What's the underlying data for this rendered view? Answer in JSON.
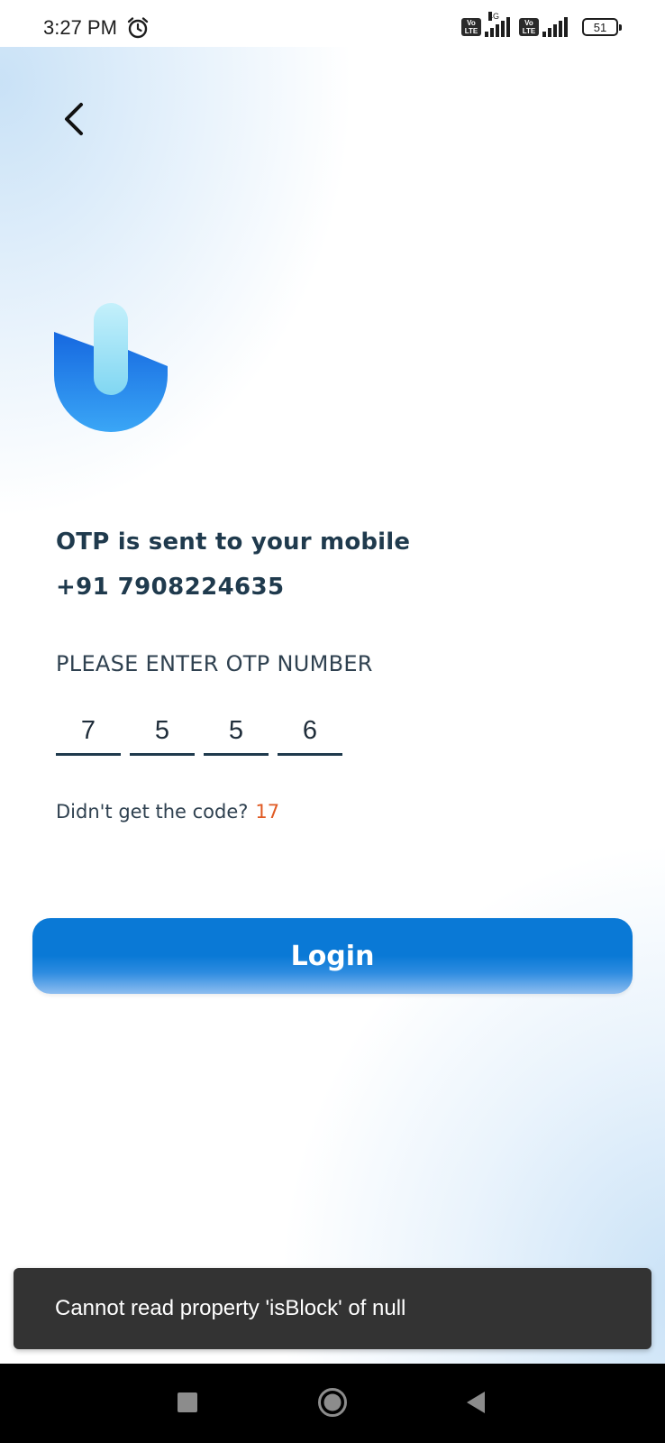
{
  "status_bar": {
    "time": "3:27 PM",
    "alarm_icon": "alarm-clock-icon",
    "volte_label_1": "Vo LTE",
    "network_type": "4G",
    "volte_label_2": "Vo LTE",
    "battery_level": "51"
  },
  "header": {
    "back_icon": "chevron-left-icon"
  },
  "logo": {
    "icon": "brand-logo-icon",
    "colors": {
      "top": "#9fe4f6",
      "bottom": "#1e7be8"
    }
  },
  "otp": {
    "sent_message": "OTP is sent to your mobile",
    "phone_number": "+91 7908224635",
    "enter_label": "PLEASE ENTER OTP NUMBER",
    "digits": [
      "7",
      "5",
      "5",
      "6"
    ],
    "resend_prompt": "Didn't get the code?",
    "resend_timer": "17"
  },
  "login_button": {
    "label": "Login"
  },
  "toast": {
    "message": "Cannot read property 'isBlock' of null"
  },
  "nav_bar": {
    "recent_icon": "square-recents-icon",
    "home_icon": "circle-home-icon",
    "back_icon": "triangle-back-icon"
  },
  "colors": {
    "accent": "#0a79d6",
    "text_dark": "#1f3a4d",
    "timer": "#e05a23",
    "toast_bg": "#333333"
  }
}
